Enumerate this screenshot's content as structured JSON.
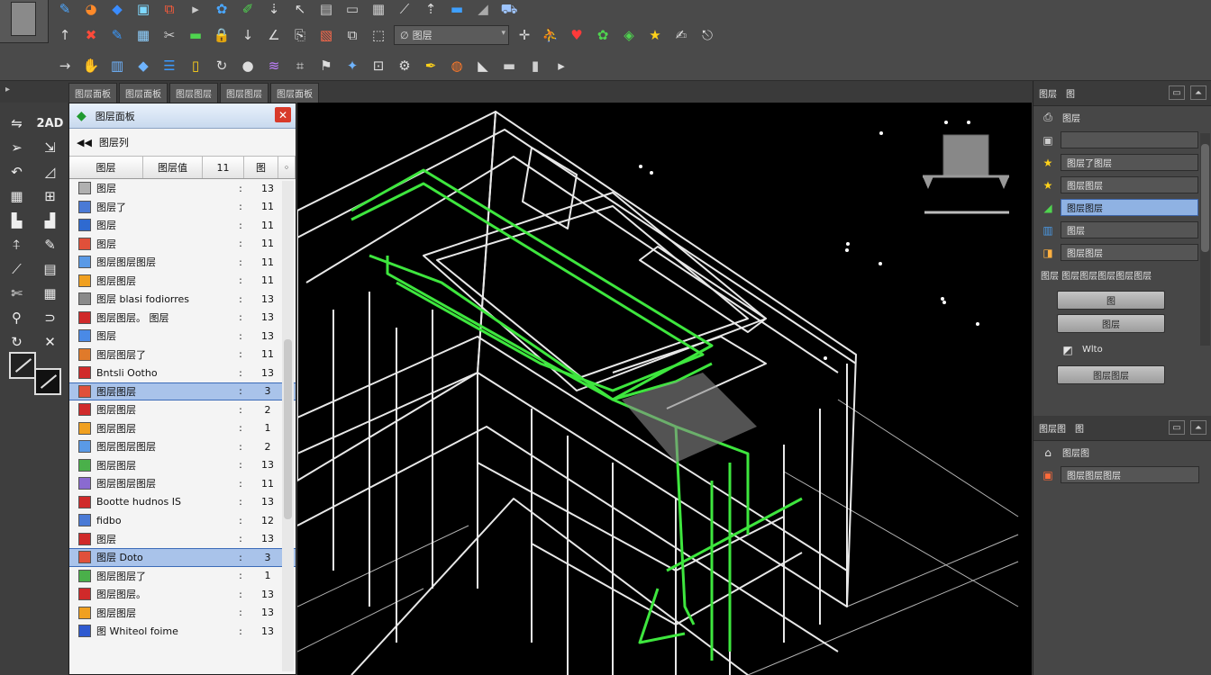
{
  "toolbar": {
    "row1": [
      {
        "name": "pen-tool-icon",
        "glyph": "✎",
        "color": "#4fa8ff"
      },
      {
        "name": "palette-icon",
        "glyph": "◕",
        "color": "#ff8a2a"
      },
      {
        "name": "fill-icon",
        "glyph": "◆",
        "color": "#3a8cff"
      },
      {
        "name": "monitor-icon",
        "glyph": "▣",
        "color": "#7fd9ff"
      },
      {
        "name": "frame-icon",
        "glyph": "⧉",
        "color": "#ff5b3a"
      },
      {
        "name": "play-icon",
        "glyph": "▸",
        "color": "#cccccc"
      },
      {
        "name": "colorwheel-icon",
        "glyph": "✿",
        "color": "#4aa7ff"
      },
      {
        "name": "brush-icon",
        "glyph": "✐",
        "color": "#4fd44f"
      },
      {
        "name": "pin-icon",
        "glyph": "⇣",
        "color": "#dddddd"
      },
      {
        "name": "pointer-icon",
        "glyph": "↖",
        "color": "#dddddd"
      },
      {
        "name": "document-icon",
        "glyph": "▤",
        "color": "#cfcfcf"
      },
      {
        "name": "window-icon",
        "glyph": "▭",
        "color": "#cfcfcf"
      },
      {
        "name": "image-icon",
        "glyph": "▦",
        "color": "#cfcfcf"
      },
      {
        "name": "magic-wand-icon",
        "glyph": "⟋",
        "color": "#dddddd"
      },
      {
        "name": "upload-icon",
        "glyph": "⇡",
        "color": "#dddddd"
      },
      {
        "name": "gradient-icon",
        "glyph": "▬",
        "color": "#3fa0ff"
      },
      {
        "name": "shapes-icon",
        "glyph": "◢",
        "color": "#aaaaaa"
      },
      {
        "name": "cart-icon",
        "glyph": "⛟",
        "color": "#9ec5ff"
      }
    ],
    "row2": [
      {
        "name": "arrow-up-icon",
        "glyph": "↑",
        "color": "#dddddd"
      },
      {
        "name": "eraser-icon",
        "glyph": "✖",
        "color": "#ff4a3a"
      },
      {
        "name": "pencil-icon",
        "glyph": "✎",
        "color": "#3a9aff"
      },
      {
        "name": "grid-icon",
        "glyph": "▦",
        "color": "#8fd0ff"
      },
      {
        "name": "scissors-icon",
        "glyph": "✂",
        "color": "#cccccc"
      },
      {
        "name": "rect-icon",
        "glyph": "▬",
        "color": "#4fd44f"
      },
      {
        "name": "lock-icon",
        "glyph": "🔒",
        "color": "#dddddd"
      },
      {
        "name": "download-icon",
        "glyph": "↓",
        "color": "#dddddd"
      },
      {
        "name": "angle-icon",
        "glyph": "∠",
        "color": "#dddddd"
      },
      {
        "name": "paste-icon",
        "glyph": "⎘",
        "color": "#dddddd"
      },
      {
        "name": "photo-icon",
        "glyph": "▧",
        "color": "#ff6a4a"
      },
      {
        "name": "copy-icon",
        "glyph": "⧉",
        "color": "#dddddd"
      },
      {
        "name": "select-icon",
        "glyph": "⬚",
        "color": "#dddddd"
      }
    ],
    "row2b": [
      {
        "name": "move-icon",
        "glyph": "✛",
        "color": "#dddddd"
      },
      {
        "name": "run-icon",
        "glyph": "⛹",
        "color": "#dddddd"
      },
      {
        "name": "heart-icon",
        "glyph": "♥",
        "color": "#ff3a3a"
      },
      {
        "name": "palette-icon",
        "glyph": "✿",
        "color": "#4fd44f"
      },
      {
        "name": "tag-icon",
        "glyph": "◈",
        "color": "#4fd44f"
      },
      {
        "name": "star-icon",
        "glyph": "★",
        "color": "#ffd21a"
      },
      {
        "name": "note-icon",
        "glyph": "✍",
        "color": "#dddddd"
      },
      {
        "name": "export-icon",
        "glyph": "⎋",
        "color": "#dddddd"
      }
    ],
    "row3": [
      {
        "name": "arrow-right-icon",
        "glyph": "→",
        "color": "#dddddd"
      },
      {
        "name": "hand-icon",
        "glyph": "✋",
        "color": "#dddddd"
      },
      {
        "name": "bars-icon",
        "glyph": "▥",
        "color": "#6fb4ff"
      },
      {
        "name": "diamond-icon",
        "glyph": "◆",
        "color": "#6fb4ff"
      },
      {
        "name": "list-icon",
        "glyph": "☰",
        "color": "#3a9aff"
      },
      {
        "name": "columns-icon",
        "glyph": "▯",
        "color": "#ffd21a"
      },
      {
        "name": "redo-icon",
        "glyph": "↻",
        "color": "#dddddd"
      },
      {
        "name": "drop-icon",
        "glyph": "●",
        "color": "#dddddd"
      },
      {
        "name": "wave-icon",
        "glyph": "≋",
        "color": "#c080ff"
      },
      {
        "name": "crop-icon",
        "glyph": "⌗",
        "color": "#dddddd"
      },
      {
        "name": "flag-icon",
        "glyph": "⚑",
        "color": "#dddddd"
      },
      {
        "name": "bird-icon",
        "glyph": "✦",
        "color": "#6fb4ff"
      },
      {
        "name": "frame2-icon",
        "glyph": "⊡",
        "color": "#dddddd"
      },
      {
        "name": "gear-icon",
        "glyph": "⚙",
        "color": "#dddddd"
      },
      {
        "name": "pen2-icon",
        "glyph": "✒",
        "color": "#ffd21a"
      },
      {
        "name": "globe-icon",
        "glyph": "◍",
        "color": "#ff7a2a"
      },
      {
        "name": "ruler-icon",
        "glyph": "◣",
        "color": "#dddddd"
      },
      {
        "name": "box-icon",
        "glyph": "▬",
        "color": "#cfcfcf"
      },
      {
        "name": "trash-icon",
        "glyph": "▮",
        "color": "#cfcfcf"
      },
      {
        "name": "more-icon",
        "glyph": "▸",
        "color": "#dddddd"
      }
    ],
    "layer_combo": "图层",
    "combo_prefix": "∅"
  },
  "tabs": [
    "图层面板",
    "图层面板",
    "图层图层",
    "图层图层",
    "图层面板"
  ],
  "tools": [
    {
      "name": "select-tool-icon",
      "glyph": "⇋"
    },
    {
      "name": "2d-tool-label",
      "glyph": "2AD"
    },
    {
      "name": "arrow-tool-icon",
      "glyph": "➢"
    },
    {
      "name": "move-tool-icon",
      "glyph": "⇲"
    },
    {
      "name": "lasso-tool-icon",
      "glyph": "↶"
    },
    {
      "name": "line-tool-icon",
      "glyph": "◿"
    },
    {
      "name": "grid-tool-icon",
      "glyph": "▦"
    },
    {
      "name": "frame-tool-icon",
      "glyph": "⊞"
    },
    {
      "name": "stamp-tool-icon",
      "glyph": "▙"
    },
    {
      "name": "chart-tool-icon",
      "glyph": "▟"
    },
    {
      "name": "pin-tool-icon",
      "glyph": "⍏"
    },
    {
      "name": "pencil-tool-icon",
      "glyph": "✎"
    },
    {
      "name": "knife-tool-icon",
      "glyph": "⟋"
    },
    {
      "name": "blur-tool-icon",
      "glyph": "▤"
    },
    {
      "name": "scissor-tool-icon",
      "glyph": "✄"
    },
    {
      "name": "page-tool-icon",
      "glyph": "▦"
    },
    {
      "name": "zoom-tool-icon",
      "glyph": "⚲"
    },
    {
      "name": "curve-tool-icon",
      "glyph": "⊃"
    },
    {
      "name": "rotate-tool-icon",
      "glyph": "↻"
    },
    {
      "name": "cross-tool-icon",
      "glyph": "✕"
    }
  ],
  "list_panel": {
    "title": "图层面板",
    "nav_label": "图层列",
    "headers": [
      "图层",
      "图层值",
      "11",
      "图"
    ],
    "rows": [
      {
        "label": "图层",
        "value": "13",
        "color": "#b0b0b0",
        "selected": false
      },
      {
        "label": "图层了",
        "value": "11",
        "color": "#4a7ad6",
        "selected": false
      },
      {
        "label": "图层",
        "value": "11",
        "color": "#2f6ad0",
        "selected": false
      },
      {
        "label": "图层",
        "value": "11",
        "color": "#e0503a",
        "selected": false
      },
      {
        "label": "图层图层图层",
        "value": "11",
        "color": "#5a9ae6",
        "selected": false
      },
      {
        "label": "图层图层",
        "value": "11",
        "color": "#f0a020",
        "selected": false
      },
      {
        "label": "图层 blasi fodiorres",
        "value": "13",
        "color": "#8a8a8a",
        "selected": false
      },
      {
        "label": "图层图层。 图层",
        "value": "13",
        "color": "#d02a2a",
        "selected": false
      },
      {
        "label": "图层",
        "value": "13",
        "color": "#4a8ae6",
        "selected": false
      },
      {
        "label": "图层图层了",
        "value": "11",
        "color": "#e07a2a",
        "selected": false
      },
      {
        "label": "Bntsli Ootho",
        "value": "13",
        "color": "#d02a2a",
        "selected": false
      },
      {
        "label": "图层图层",
        "value": "3",
        "color": "#e0503a",
        "selected": true
      },
      {
        "label": "图层图层",
        "value": "2",
        "color": "#d02a2a",
        "selected": false
      },
      {
        "label": "图层图层",
        "value": "1",
        "color": "#f0a020",
        "selected": false
      },
      {
        "label": "图层图层图层",
        "value": "2",
        "color": "#5a9ae6",
        "selected": false
      },
      {
        "label": "图层图层",
        "value": "13",
        "color": "#4ab04a",
        "selected": false
      },
      {
        "label": "图层图层图层",
        "value": "11",
        "color": "#8a6ad0",
        "selected": false
      },
      {
        "label": "Bootte hudnos IS",
        "value": "13",
        "color": "#d02a2a",
        "selected": false
      },
      {
        "label": "fidbo",
        "value": "12",
        "color": "#4a7ad6",
        "selected": false
      },
      {
        "label": "图层",
        "value": "13",
        "color": "#d02a2a",
        "selected": false
      },
      {
        "label": "图层 Doto",
        "value": "3",
        "color": "#e0503a",
        "selected": true
      },
      {
        "label": "图层图层了",
        "value": "1",
        "color": "#4ab04a",
        "selected": false
      },
      {
        "label": "图层图层。",
        "value": "13",
        "color": "#d02a2a",
        "selected": false
      },
      {
        "label": "图层图层",
        "value": "13",
        "color": "#f0a020",
        "selected": false
      },
      {
        "label": "图 Whiteol foime",
        "value": "13",
        "color": "#2f5ad0",
        "selected": false
      }
    ],
    "colon": ":"
  },
  "right_panel": {
    "header_tabs": [
      "图层",
      "图"
    ],
    "title": "图层",
    "rows": [
      {
        "label": "",
        "icon": "▣",
        "color": "#cccccc",
        "highlight": false
      },
      {
        "label": "图层了图层",
        "icon": "★",
        "color": "#ffd21a",
        "highlight": false
      },
      {
        "label": "图层图层",
        "icon": "★",
        "color": "#ffd21a",
        "highlight": false
      },
      {
        "label": "图层图层",
        "icon": "◢",
        "color": "#4fd44f",
        "highlight": true
      },
      {
        "label": "图层",
        "icon": "▥",
        "color": "#4a9ae6",
        "highlight": false
      },
      {
        "label": "图层图层",
        "icon": "◨",
        "color": "#ffb040",
        "highlight": false
      }
    ],
    "breadcrumb": "图层 图层图层图层图层图层",
    "buttons": [
      "图",
      "图层",
      "图层图层"
    ],
    "pen_label": "Wlto",
    "section2": {
      "tabs": [
        "图层图",
        "图"
      ],
      "title": "图层图",
      "item": "图层图层图层"
    }
  }
}
